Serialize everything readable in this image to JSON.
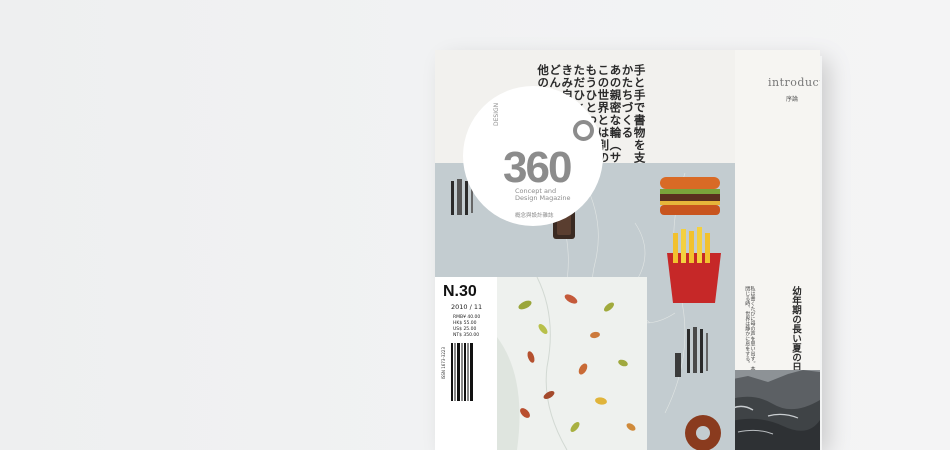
{
  "cover": {
    "title_lines": [
      "手と手で書物を支え、",
      "かたちづくる",
      "あの親密な輪（サークル）、",
      "この世界とは別の",
      "もうひとつの世界。",
      "ただひとり",
      "きみ自身の異質性。",
      "どんなとき",
      "他の誰"
    ],
    "logo": {
      "number": "360",
      "design_label": "DESIGN",
      "subtitle_line1": "Concept and",
      "subtitle_line2": "Design Magazine",
      "subtitle_cn": "概念與設計雜誌"
    },
    "issue": {
      "number": "N.30",
      "date": "2010 / 11",
      "prices": [
        "RMB¥ 40.00",
        "HK$ 55.00",
        "US$ 25.00",
        "NT$ 350.00"
      ],
      "isbn": "ISSN 1673-3223"
    }
  },
  "back_page": {
    "intro_label": "introductie",
    "intro_sub": "序論",
    "heading": "幼年期の長い夏の日々を、",
    "body_text": "私は書くたびに母の声を思い出す。本を閉じる時、世界は静かに息をする。"
  },
  "colors": {
    "background": "#f0f1f2",
    "cover_paper": "#f2f1ee",
    "art_blue": "#c3ccd0",
    "logo_grey": "#8c8c8c"
  }
}
